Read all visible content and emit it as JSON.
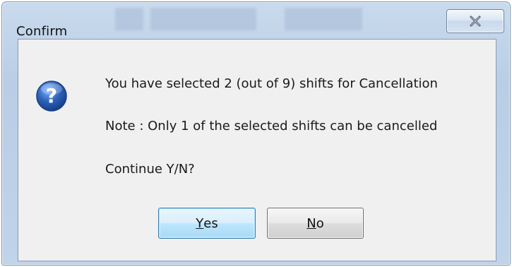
{
  "dialog": {
    "title": "Confirm",
    "close_icon": "close-icon",
    "icon": "question-icon",
    "message_line1": "You have selected 2 (out of 9) shifts for Cancellation",
    "message_line2": "Note : Only 1 of the selected shifts can be cancelled",
    "message_line3": "Continue Y/N?",
    "yes_button": {
      "mnemonic": "Y",
      "rest": "es"
    },
    "no_button": {
      "mnemonic": "N",
      "rest": "o"
    }
  },
  "colors": {
    "titlebar": "#bfd3ea",
    "client": "#f0f0f0",
    "icon_blue": "#2d62b8",
    "default_button_border": "#3c7fb1"
  }
}
